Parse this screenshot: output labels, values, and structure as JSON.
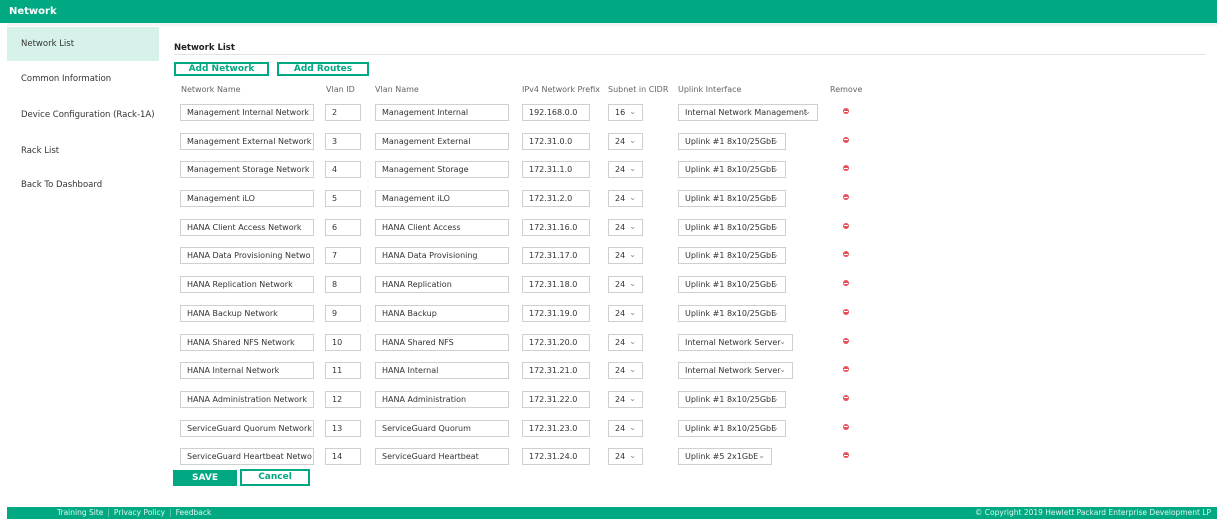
{
  "header": {
    "title": "Network"
  },
  "sidebar": {
    "items": [
      {
        "label": "Network List",
        "active": true
      },
      {
        "label": "Common Information"
      },
      {
        "label": "Device Configuration (Rack-1A)"
      },
      {
        "label": "Rack List"
      },
      {
        "label": "Back To Dashboard"
      }
    ]
  },
  "main": {
    "section_title": "Network List",
    "add_network_label": "Add Network",
    "add_routes_label": "Add Routes",
    "columns": [
      "Network Name",
      "Vlan ID",
      "Vlan Name",
      "IPv4 Network Prefix",
      "Subnet in CIDR",
      "Uplink Interface",
      "Remove"
    ],
    "rows": [
      {
        "name": "Management Internal Network",
        "vlan_id": "2",
        "vlan_name": "Management Internal",
        "prefix": "192.168.0.0",
        "cidr": "16",
        "uplink": "Internal Network Management"
      },
      {
        "name": "Management External Network",
        "vlan_id": "3",
        "vlan_name": "Management External",
        "prefix": "172.31.0.0",
        "cidr": "24",
        "uplink": "Uplink #1 8x10/25GbE"
      },
      {
        "name": "Management Storage Network",
        "vlan_id": "4",
        "vlan_name": "Management Storage",
        "prefix": "172.31.1.0",
        "cidr": "24",
        "uplink": "Uplink #1 8x10/25GbE"
      },
      {
        "name": "Management iLO",
        "vlan_id": "5",
        "vlan_name": "Management iLO",
        "prefix": "172.31.2.0",
        "cidr": "24",
        "uplink": "Uplink #1 8x10/25GbE"
      },
      {
        "name": "HANA Client Access Network",
        "vlan_id": "6",
        "vlan_name": "HANA Client Access",
        "prefix": "172.31.16.0",
        "cidr": "24",
        "uplink": "Uplink #1 8x10/25GbE"
      },
      {
        "name": "HANA Data Provisioning Netwo",
        "vlan_id": "7",
        "vlan_name": "HANA Data Provisioning",
        "prefix": "172.31.17.0",
        "cidr": "24",
        "uplink": "Uplink #1 8x10/25GbE"
      },
      {
        "name": "HANA Replication Network",
        "vlan_id": "8",
        "vlan_name": "HANA Replication",
        "prefix": "172.31.18.0",
        "cidr": "24",
        "uplink": "Uplink #1 8x10/25GbE"
      },
      {
        "name": "HANA Backup Network",
        "vlan_id": "9",
        "vlan_name": "HANA Backup",
        "prefix": "172.31.19.0",
        "cidr": "24",
        "uplink": "Uplink #1 8x10/25GbE"
      },
      {
        "name": "HANA Shared NFS Network",
        "vlan_id": "10",
        "vlan_name": "HANA Shared NFS",
        "prefix": "172.31.20.0",
        "cidr": "24",
        "uplink": "Internal Network Server"
      },
      {
        "name": "HANA Internal Network",
        "vlan_id": "11",
        "vlan_name": "HANA Internal",
        "prefix": "172.31.21.0",
        "cidr": "24",
        "uplink": "Internal Network Server"
      },
      {
        "name": "HANA Administration Network",
        "vlan_id": "12",
        "vlan_name": "HANA Administration",
        "prefix": "172.31.22.0",
        "cidr": "24",
        "uplink": "Uplink #1 8x10/25GbE"
      },
      {
        "name": "ServiceGuard Quorum Network",
        "vlan_id": "13",
        "vlan_name": "ServiceGuard Quorum",
        "prefix": "172.31.23.0",
        "cidr": "24",
        "uplink": "Uplink #1 8x10/25GbE"
      },
      {
        "name": "ServiceGuard Heartbeat Netwo",
        "vlan_id": "14",
        "vlan_name": "ServiceGuard Heartbeat",
        "prefix": "172.31.24.0",
        "cidr": "24",
        "uplink": "Uplink #5 2x1GbE"
      }
    ],
    "save_label": "SAVE",
    "cancel_label": "Cancel"
  },
  "footer": {
    "links": [
      "Training Site",
      "Privacy Policy",
      "Feedback"
    ],
    "copyright": "© Copyright 2019 Hewlett Packard Enterprise Development LP"
  },
  "colors": {
    "accent": "#01a982",
    "active_nav": "#d6f2ea",
    "remove": "#e8505b"
  },
  "icons": {
    "remove": "remove-icon",
    "dropdown": "chevron-down-icon"
  }
}
